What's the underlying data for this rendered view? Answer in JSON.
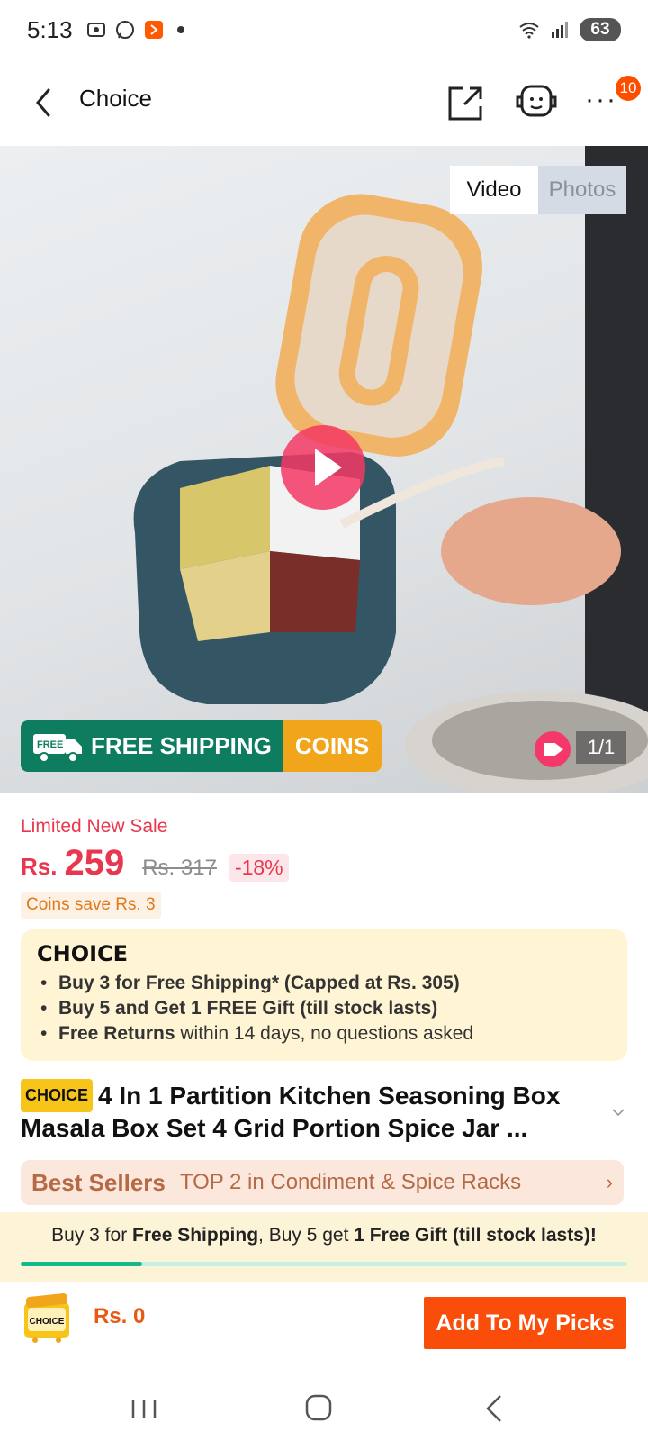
{
  "status_bar": {
    "time": "5:13",
    "battery": "63"
  },
  "header": {
    "title": "Choice",
    "more_badge": "10"
  },
  "media": {
    "tabs": [
      "Video",
      "Photos"
    ],
    "counter": "1/1",
    "shipping_label": "FREE SHIPPING",
    "coins_label": "COINS",
    "free_tag": "FREE"
  },
  "price": {
    "sale_label": "Limited New Sale",
    "currency": "Rs.",
    "current": "259",
    "original": "Rs. 317",
    "discount": "-18%",
    "coins_save": "Coins save Rs. 3"
  },
  "choice_box": {
    "logo": "CHOICE",
    "line1_bold": "Buy 3 for  Free Shipping* (Capped at Rs. 305)",
    "line2_bold": "Buy 5 and Get 1 FREE Gift (till stock lasts)",
    "line3_bold": "Free Returns",
    "line3_rest": " within 14 days, no questions asked"
  },
  "product": {
    "tag": "CHOICE",
    "title": "4 In 1 Partition Kitchen Seasoning Box Masala Box Set 4 Grid Portion Spice Jar ..."
  },
  "best_sellers": {
    "label": "Best Sellers",
    "rank": "TOP 2 in Condiment & Spice Racks"
  },
  "promo": {
    "part1": "Buy 3 for ",
    "part2_bold": "Free Shipping",
    "part3": ", Buy 5 get ",
    "part4_bold": "1 Free Gift (till stock lasts)!",
    "progress": 0.2
  },
  "bottom": {
    "cart_label": "CHOICE",
    "cart_price": "Rs. 0",
    "add_button": "Add To My Picks"
  },
  "colors": {
    "accent": "#fb4d0a",
    "price_red": "#e8384f",
    "shipping_green": "#0e7d5f",
    "coins_orange": "#f0a51a",
    "progress_green": "#14b88c"
  }
}
